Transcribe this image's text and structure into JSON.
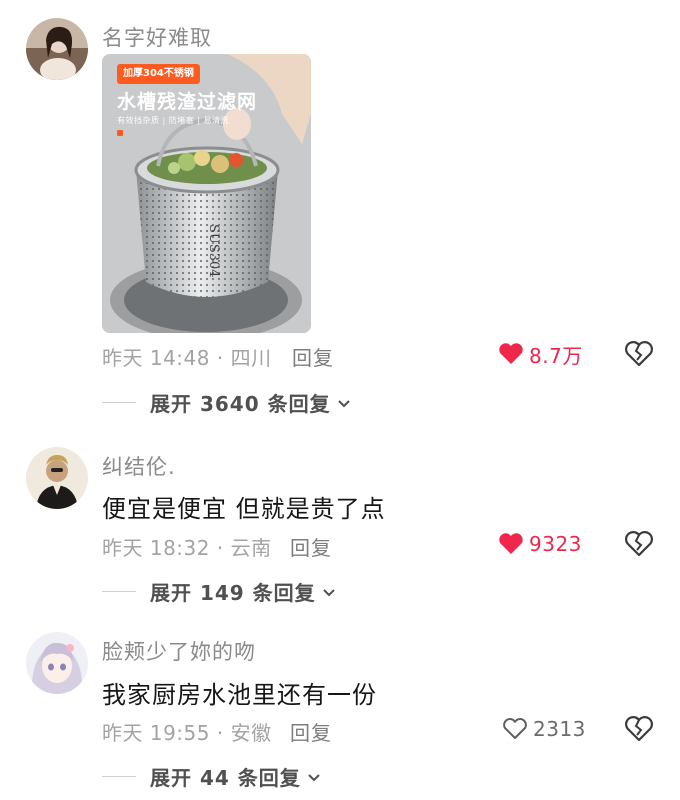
{
  "comments": [
    {
      "username": "名字好难取",
      "text": "",
      "image": {
        "badge": "加厚304不锈钢",
        "title": "水槽残渣过滤网",
        "subtitle": "有效挡杂质 | 防堵塞 | 易清洗",
        "engraving": "SUS304"
      },
      "time": "昨天 14:48 · 四川",
      "reply_label": "回复",
      "likes": "8.7万",
      "liked": true,
      "expand_label": "展开 3640 条回复"
    },
    {
      "username": "纠结伦.",
      "text": "便宜是便宜 但就是贵了点",
      "time": "昨天 18:32 · 云南",
      "reply_label": "回复",
      "likes": "9323",
      "liked": true,
      "expand_label": "展开 149 条回复"
    },
    {
      "username": "脸颊少了妳的吻",
      "text": "我家厨房水池里还有一份",
      "time": "昨天 19:55 · 安徽",
      "reply_label": "回复",
      "likes": "2313",
      "liked": false,
      "expand_label": "展开 44 条回复"
    }
  ],
  "colors": {
    "liked": "#f0274c",
    "meta": "#a3a3a3",
    "username": "#8a8a8a"
  },
  "icons": [
    "heart-icon",
    "broken-heart-icon",
    "chevron-down-icon"
  ]
}
